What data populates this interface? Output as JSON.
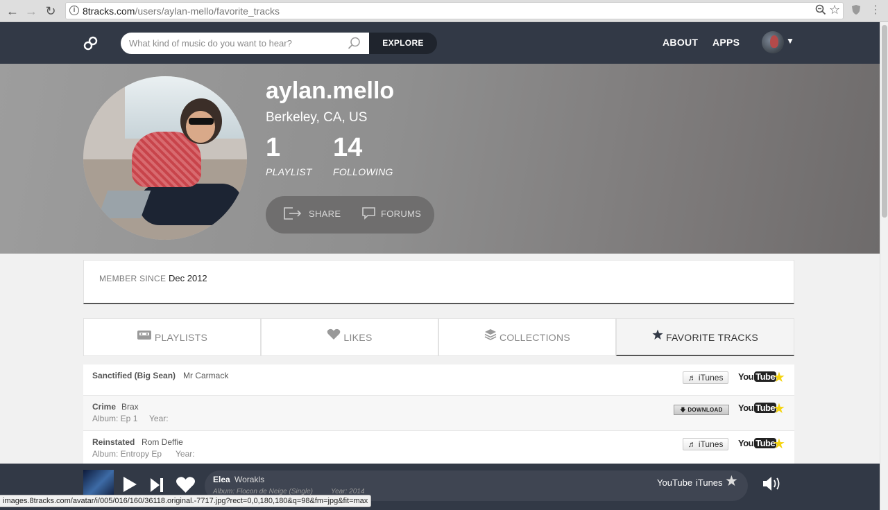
{
  "browser": {
    "url_host": "8tracks.com",
    "url_path": "/users/aylan-mello/favorite_tracks",
    "status_url": "images.8tracks.com/avatar/i/005/016/160/36118.original.-7717.jpg?rect=0,0,180,180&q=98&fm=jpg&fit=max"
  },
  "header": {
    "search_placeholder": "What kind of music do you want to hear?",
    "explore_label": "EXPLORE",
    "about_label": "ABOUT",
    "apps_label": "APPS"
  },
  "profile": {
    "username": "aylan.mello",
    "location": "Berkeley, CA, US",
    "stats": [
      {
        "value": "1",
        "label": "PLAYLIST"
      },
      {
        "value": "14",
        "label": "FOLLOWING"
      }
    ],
    "share_label": "SHARE",
    "forums_label": "FORUMS"
  },
  "member": {
    "label": "MEMBER SINCE",
    "value": "Dec 2012"
  },
  "tabs": [
    {
      "label": "PLAYLISTS",
      "icon": "cassette-icon",
      "active": false
    },
    {
      "label": "LIKES",
      "icon": "heart-icon",
      "active": false
    },
    {
      "label": "COLLECTIONS",
      "icon": "layers-icon",
      "active": false
    },
    {
      "label": "FAVORITE TRACKS",
      "icon": "star-icon",
      "active": true
    }
  ],
  "tracks": [
    {
      "title": "Sanctified (Big Sean)",
      "artist": "Mr Carmack",
      "album": "",
      "year": "",
      "buy": "iTunes"
    },
    {
      "title": "Crime",
      "artist": "Brax",
      "album": "Album: Ep 1",
      "year": "Year:",
      "buy": "DOWNLOAD"
    },
    {
      "title": "Reinstated",
      "artist": "Rom Deffie",
      "album": "Album: Entropy Ep",
      "year": "Year:",
      "buy": "iTunes"
    }
  ],
  "track_links": {
    "youtube_you": "You",
    "youtube_tube": "Tube"
  },
  "player": {
    "title": "Elea",
    "artist": "Worakls",
    "album": "Album: Flocon de Neige (Single)",
    "year": "Year: 2014",
    "youtube_label": "YouTube",
    "itunes_label": "iTunes"
  },
  "colors": {
    "header_bg": "#323946",
    "favorite_star": "#f5d410"
  }
}
